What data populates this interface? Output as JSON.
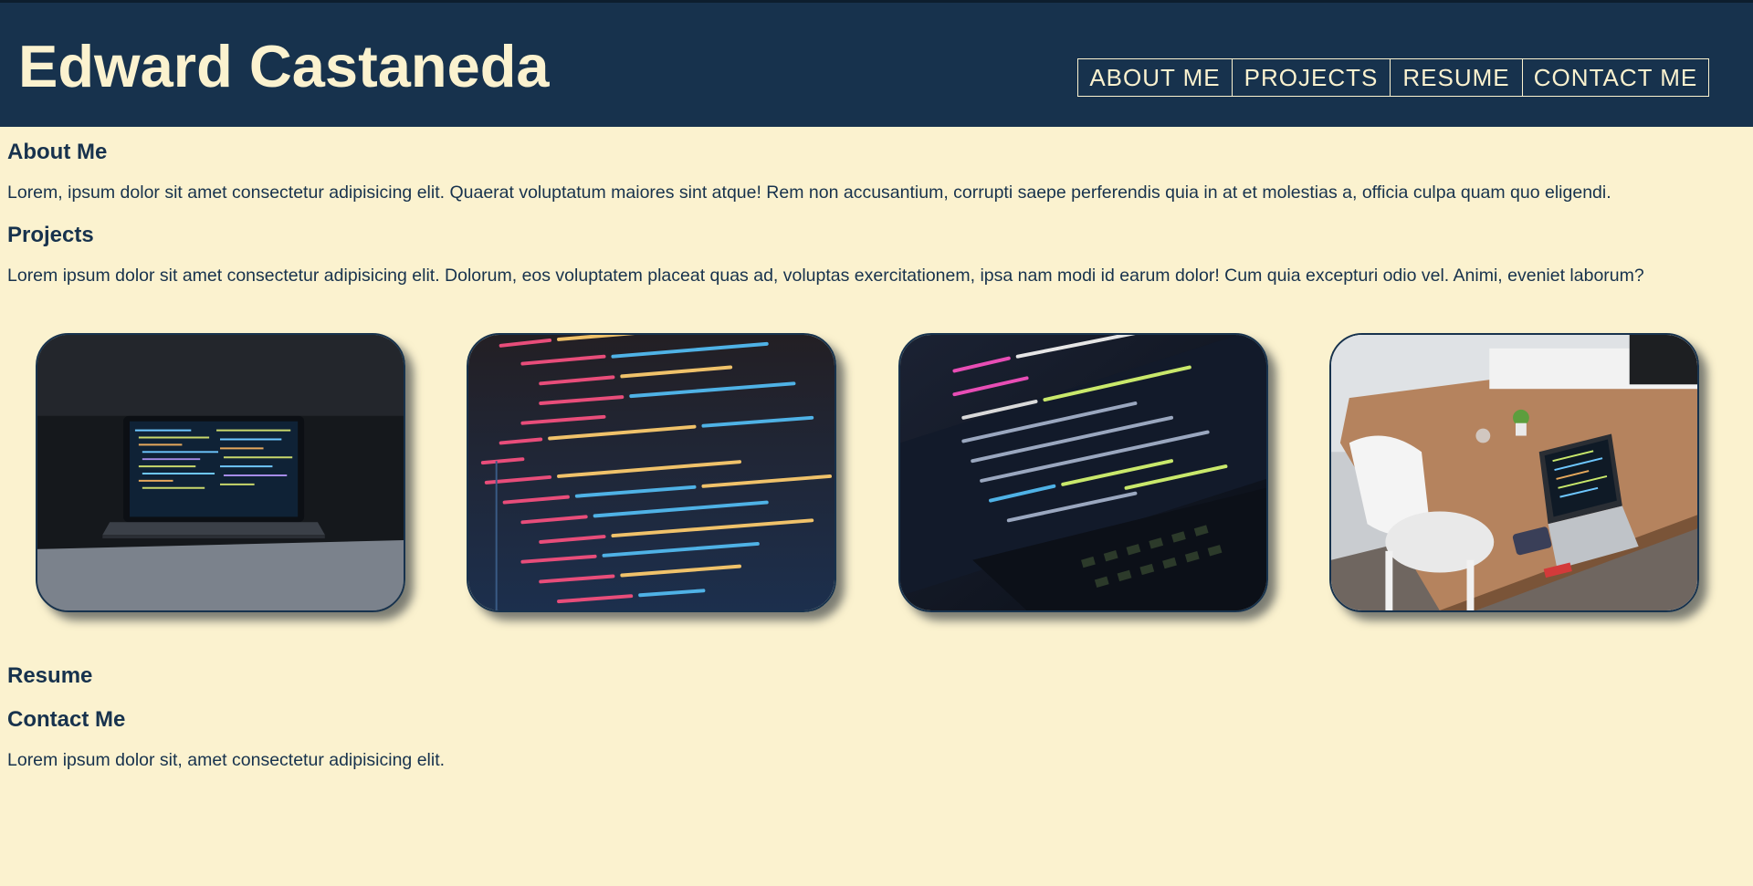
{
  "header": {
    "site_name": "Edward Castaneda",
    "nav": [
      "ABOUT ME",
      "PROJECTS",
      "RESUME",
      "CONTACT ME"
    ]
  },
  "about": {
    "heading": "About Me",
    "body": "Lorem, ipsum dolor sit amet consectetur adipisicing elit. Quaerat voluptatum maiores sint atque! Rem non accusantium, corrupti saepe perferendis quia in at et molestias a, officia culpa quam quo eligendi."
  },
  "projects": {
    "heading": "Projects",
    "body": "Lorem ipsum dolor sit amet consectetur adipisicing elit. Dolorum, eos voluptatem placeat quas ad, voluptas exercitationem, ipsa nam modi id earum dolor! Cum quia excepturi odio vel. Animi, eveniet laborum?"
  },
  "resume": {
    "heading": "Resume"
  },
  "contact": {
    "heading": "Contact Me",
    "body": "Lorem ipsum dolor sit, amet consectetur adipisicing elit."
  },
  "colors": {
    "header_bg": "#17324d",
    "page_bg": "#fbf2cf",
    "text": "#17324d"
  }
}
